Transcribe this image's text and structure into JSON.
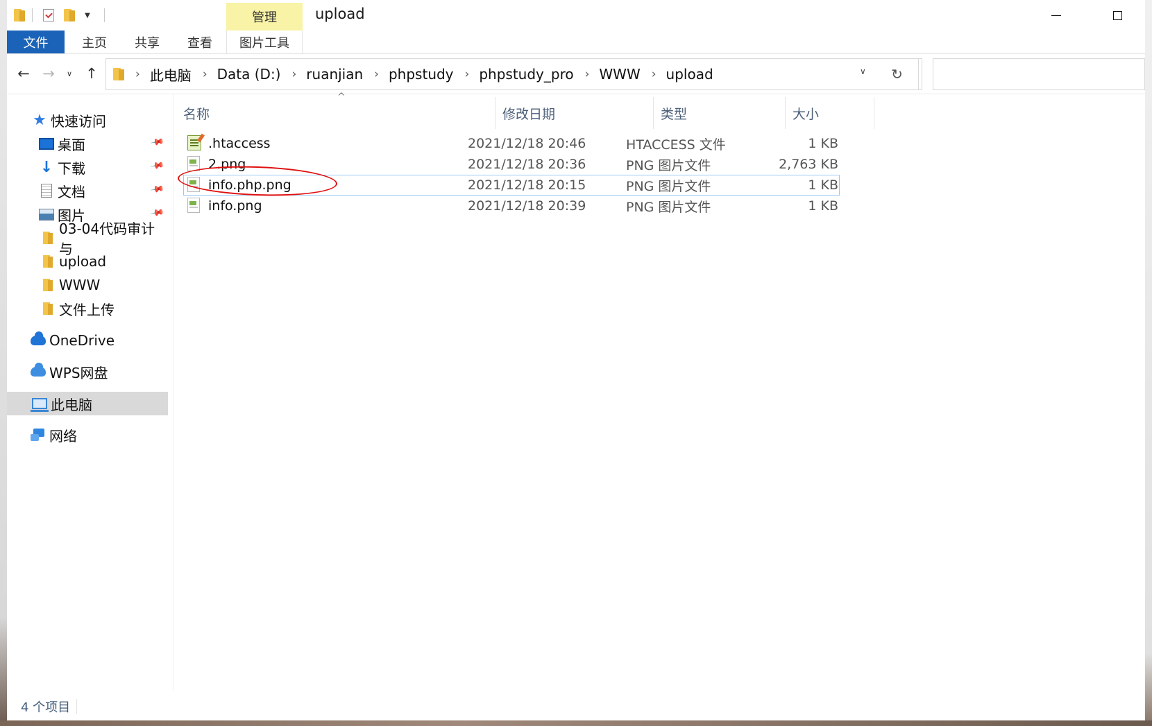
{
  "window": {
    "title": "upload",
    "manage_tab": "管理"
  },
  "ribbon": {
    "tabs": [
      {
        "label": "文件"
      },
      {
        "label": "主页"
      },
      {
        "label": "共享"
      },
      {
        "label": "查看"
      },
      {
        "label": "图片工具"
      }
    ]
  },
  "address": {
    "crumbs": [
      "此电脑",
      "Data (D:)",
      "ruanjian",
      "phpstudy",
      "phpstudy_pro",
      "WWW",
      "upload"
    ],
    "search_placeholder": ""
  },
  "nav": {
    "items": [
      {
        "label": "快速访问",
        "icon": "star-icon"
      },
      {
        "label": "桌面",
        "icon": "desktop-icon",
        "pinned": true
      },
      {
        "label": "下载",
        "icon": "download-icon",
        "pinned": true
      },
      {
        "label": "文档",
        "icon": "document-icon",
        "pinned": true
      },
      {
        "label": "图片",
        "icon": "pictures-icon",
        "pinned": true
      },
      {
        "label": "03-04代码审计与",
        "icon": "folder-icon"
      },
      {
        "label": "upload",
        "icon": "folder-icon"
      },
      {
        "label": "WWW",
        "icon": "folder-icon"
      },
      {
        "label": "文件上传",
        "icon": "folder-icon"
      },
      {
        "label": "OneDrive",
        "icon": "onedrive-cloud-icon"
      },
      {
        "label": "WPS网盘",
        "icon": "wps-cloud-icon"
      },
      {
        "label": "此电脑",
        "icon": "this-pc-icon",
        "selected": true
      },
      {
        "label": "网络",
        "icon": "network-icon"
      }
    ]
  },
  "files": {
    "columns": [
      "名称",
      "修改日期",
      "类型",
      "大小"
    ],
    "rows": [
      {
        "name": ".htaccess",
        "date": "2021/12/18 20:46",
        "type": "HTACCESS 文件",
        "size": "1 KB",
        "icon": "htaccess-file-icon"
      },
      {
        "name": "2.png",
        "date": "2021/12/18 20:36",
        "type": "PNG 图片文件",
        "size": "2,763 KB",
        "icon": "png-file-icon"
      },
      {
        "name": "info.php.png",
        "date": "2021/12/18 20:15",
        "type": "PNG 图片文件",
        "size": "1 KB",
        "icon": "png-file-icon",
        "focused": true
      },
      {
        "name": "info.png",
        "date": "2021/12/18 20:39",
        "type": "PNG 图片文件",
        "size": "1 KB",
        "icon": "png-file-icon"
      }
    ]
  },
  "status": {
    "item_count": "4 个项目"
  },
  "colors": {
    "file_tab": "#1a63b8",
    "context_tab": "#f8f3a6",
    "annotation": "#e01010",
    "selection": "#d9d9d9"
  }
}
